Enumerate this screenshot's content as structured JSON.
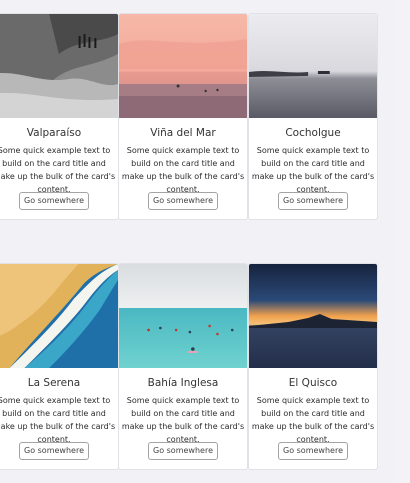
{
  "cards": [
    {
      "title": "Valparaíso",
      "text": "Some quick example text to build on the card title and make up the bulk of the card's content.",
      "button": "Go somewhere",
      "image_icon": "beach-aerial-bw-image"
    },
    {
      "title": "Viña del Mar",
      "text": "Some quick example text to build on the card title and make up the bulk of the card's content.",
      "button": "Go somewhere",
      "image_icon": "pink-sunset-beach-image"
    },
    {
      "title": "Cocholgue",
      "text": "Some quick example text to build on the card title and make up the bulk of the card's content.",
      "button": "Go somewhere",
      "image_icon": "misty-sea-image"
    },
    {
      "title": "La Serena",
      "text": "Some quick example text to build on the card title and make up the bulk of the card's content.",
      "button": "Go somewhere",
      "image_icon": "aerial-shoreline-image"
    },
    {
      "title": "Bahía Inglesa",
      "text": "Some quick example text to build on the card title and make up the bulk of the card's content.",
      "button": "Go somewhere",
      "image_icon": "turquoise-beach-image"
    },
    {
      "title": "El Quisco",
      "text": "Some quick example text to build on the card title and make up the bulk of the card's content.",
      "button": "Go somewhere",
      "image_icon": "sunset-bay-image"
    }
  ]
}
